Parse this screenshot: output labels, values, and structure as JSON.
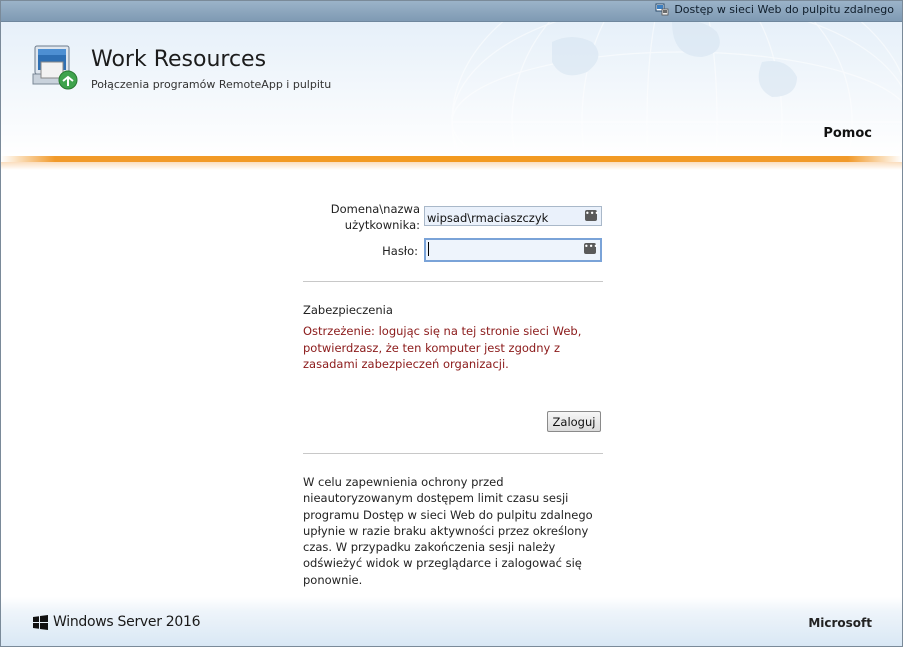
{
  "topbar": {
    "link_label": "Dostęp w sieci Web do pulpitu zdalnego",
    "icon": "remote-desktop-icon"
  },
  "header": {
    "title": "Work Resources",
    "subtitle": "Połączenia programów RemoteApp i pulpitu",
    "help_label": "Pomoc",
    "logo": "remoteapp-logo-icon"
  },
  "form": {
    "username_label_line1": "Domena\\nazwa",
    "username_label_line2": "użytkownika:",
    "username_value": "wipsad\\rmaciaszczyk",
    "password_label": "Hasło:",
    "password_value": "",
    "key_icon": "credential-icon"
  },
  "security": {
    "title": "Zabezpieczenia",
    "warning": "Ostrzeżenie: logując się na tej stronie sieci Web, potwierdzasz, że ten komputer jest zgodny z zasadami zabezpieczeń organizacji."
  },
  "login_button": "Zaloguj",
  "info_text": "W celu zapewnienia ochrony przed nieautoryzowanym dostępem limit czasu sesji programu Dostęp w sieci Web do pulpitu zdalnego upłynie w razie braku aktywności przez określony czas. W przypadku zakończenia sesji należy odświeżyć widok w przeglądarce i zalogować się ponownie.",
  "footer": {
    "product": "Windows Server 2016",
    "vendor": "Microsoft",
    "windows_logo": "windows-logo-icon"
  },
  "colors": {
    "accent_orange": "#f39a20",
    "warning_red": "#8b1a1a",
    "topbar": "#8fa8bf"
  }
}
